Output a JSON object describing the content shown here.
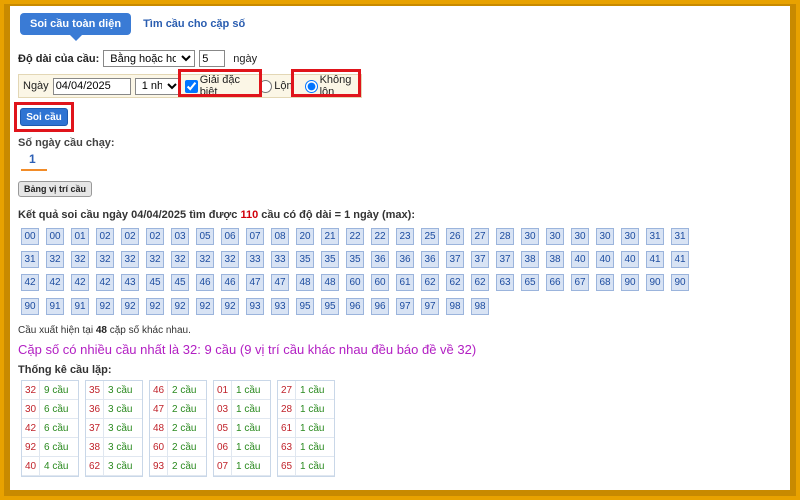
{
  "tabs": {
    "active": "Soi cầu toàn diện",
    "other": "Tìm cầu cho cặp số"
  },
  "length": {
    "label": "Độ dài của cầu:",
    "select": "Bằng hoặc hơn",
    "value": "5",
    "unit": "ngày"
  },
  "filter": {
    "date_label": "Ngày",
    "date": "04/04/2025",
    "day_select": "1 nháy",
    "special_label": "Giải đặc biệt",
    "mixed_label": "Lộn",
    "no_mixed_label": "Không lộn"
  },
  "button": "Soi cầu",
  "running_days": {
    "label": "Số ngày cầu chạy:",
    "value": "1"
  },
  "position_button": "Bảng vị trí cầu",
  "result": {
    "prefix": "Kết quả soi cầu ngày 04/04/2025 tìm được ",
    "count": "110",
    "suffix": " cầu có độ dài = 1 ngày (max):"
  },
  "numbers": [
    "00",
    "00",
    "01",
    "02",
    "02",
    "02",
    "03",
    "05",
    "06",
    "07",
    "08",
    "20",
    "21",
    "22",
    "22",
    "23",
    "25",
    "26",
    "27",
    "28",
    "30",
    "30",
    "30",
    "30",
    "30",
    "31",
    "31",
    "31",
    "32",
    "32",
    "32",
    "32",
    "32",
    "32",
    "32",
    "32",
    "33",
    "33",
    "35",
    "35",
    "35",
    "36",
    "36",
    "36",
    "37",
    "37",
    "37",
    "38",
    "38",
    "40",
    "40",
    "40",
    "41",
    "41",
    "42",
    "42",
    "42",
    "42",
    "43",
    "45",
    "45",
    "46",
    "46",
    "47",
    "47",
    "48",
    "48",
    "60",
    "60",
    "61",
    "62",
    "62",
    "62",
    "63",
    "65",
    "66",
    "67",
    "68",
    "90",
    "90",
    "90",
    "90",
    "91",
    "91",
    "92",
    "92",
    "92",
    "92",
    "92",
    "92",
    "93",
    "93",
    "95",
    "95",
    "96",
    "96",
    "97",
    "97",
    "98",
    "98"
  ],
  "note": {
    "prefix": "Cầu xuất hiện tại ",
    "count": "48",
    "suffix": " cặp số khác nhau."
  },
  "headline": "Cặp số có nhiều cầu nhất là 32: 9 cầu (9 vị trí cầu khác nhau đều báo đề về 32)",
  "stats_title": "Thống kê cầu lặp:",
  "stats": [
    [
      [
        "32",
        "9 cầu"
      ],
      [
        "30",
        "6 cầu"
      ],
      [
        "42",
        "6 cầu"
      ],
      [
        "92",
        "6 cầu"
      ],
      [
        "40",
        "4 cầu"
      ]
    ],
    [
      [
        "35",
        "3 cầu"
      ],
      [
        "36",
        "3 cầu"
      ],
      [
        "37",
        "3 cầu"
      ],
      [
        "38",
        "3 cầu"
      ],
      [
        "62",
        "3 cầu"
      ]
    ],
    [
      [
        "46",
        "2 cầu"
      ],
      [
        "47",
        "2 cầu"
      ],
      [
        "48",
        "2 cầu"
      ],
      [
        "60",
        "2 cầu"
      ],
      [
        "93",
        "2 cầu"
      ]
    ],
    [
      [
        "01",
        "1 cầu"
      ],
      [
        "03",
        "1 cầu"
      ],
      [
        "05",
        "1 cầu"
      ],
      [
        "06",
        "1 cầu"
      ],
      [
        "07",
        "1 cầu"
      ]
    ],
    [
      [
        "27",
        "1 cầu"
      ],
      [
        "28",
        "1 cầu"
      ],
      [
        "61",
        "1 cầu"
      ],
      [
        "63",
        "1 cầu"
      ],
      [
        "65",
        "1 cầu"
      ]
    ]
  ]
}
